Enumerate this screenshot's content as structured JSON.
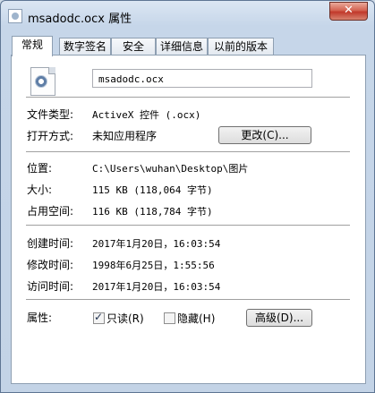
{
  "window": {
    "title": "msadodc.ocx 属性",
    "close_glyph": "✕"
  },
  "tabs": [
    {
      "label": "常规",
      "active": true
    },
    {
      "label": "数字签名"
    },
    {
      "label": "安全"
    },
    {
      "label": "详细信息"
    },
    {
      "label": "以前的版本"
    }
  ],
  "file": {
    "icon": "activex-file-icon",
    "name": "msadodc.ocx"
  },
  "type": {
    "label": "文件类型:",
    "value": "ActiveX 控件 (.ocx)"
  },
  "opens_with": {
    "label": "打开方式:",
    "value": "未知应用程序",
    "button": "更改(C)..."
  },
  "location": {
    "label": "位置:",
    "value": "C:\\Users\\wuhan\\Desktop\\图片"
  },
  "size": {
    "label": "大小:",
    "value": "115 KB (118,064 字节)"
  },
  "size_on_disk": {
    "label": "占用空间:",
    "value": "116 KB (118,784 字节)"
  },
  "created": {
    "label": "创建时间:",
    "value": "2017年1月20日，16:03:54"
  },
  "modified": {
    "label": "修改时间:",
    "value": "1998年6月25日，1:55:56"
  },
  "accessed": {
    "label": "访问时间:",
    "value": "2017年1月20日，16:03:54"
  },
  "attributes": {
    "label": "属性:",
    "readonly_label": "只读(R)",
    "readonly_checked": true,
    "hidden_label": "隐藏(H)",
    "hidden_checked": false,
    "advanced_button": "高级(D)..."
  }
}
